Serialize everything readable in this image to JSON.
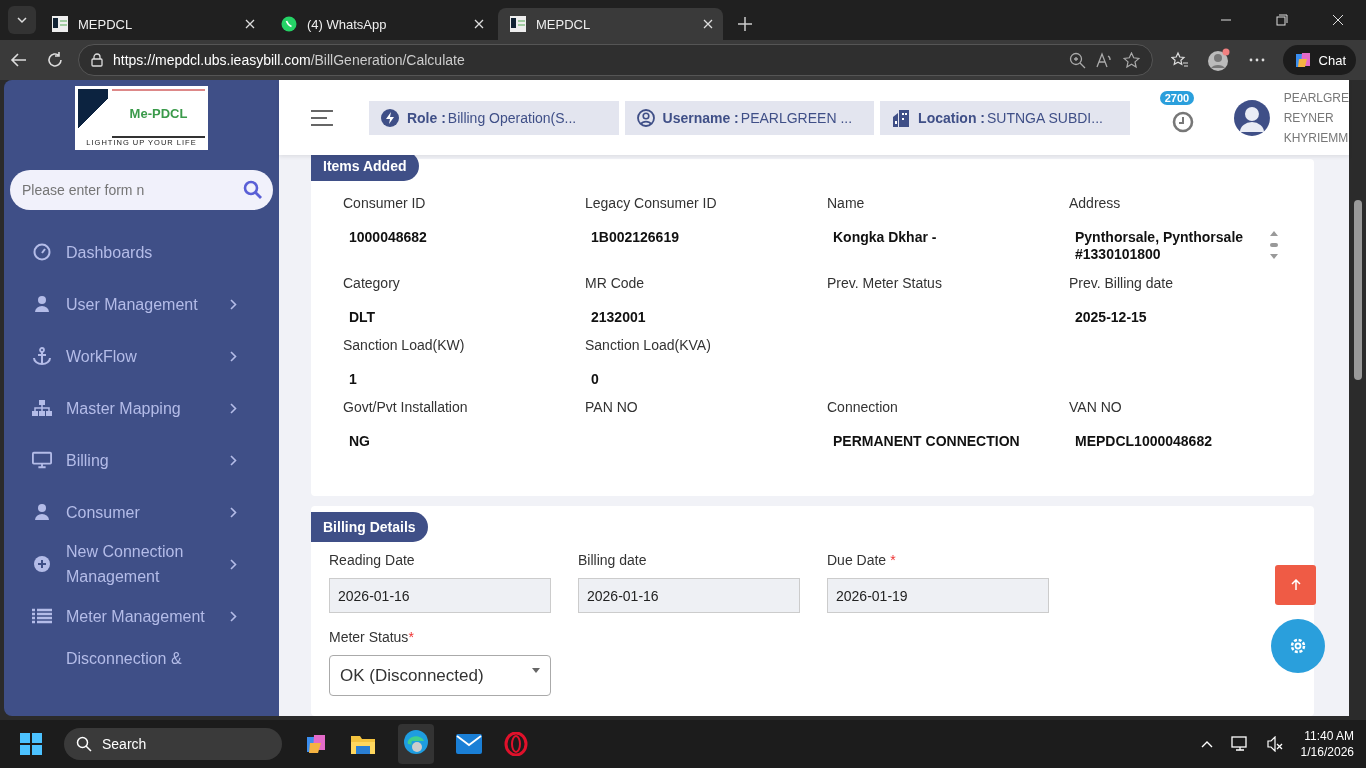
{
  "browser": {
    "tabs": [
      {
        "title": "MEPDCL",
        "selected": false
      },
      {
        "title": "(4) WhatsApp",
        "selected": false
      },
      {
        "title": "MEPDCL",
        "selected": true
      }
    ],
    "url_host": "https://mepdcl.ubs.ieasybill.com",
    "url_path": "/BillGeneration/Calculate",
    "chat": "Chat"
  },
  "sidebar": {
    "logo_text": "Me-PDCL",
    "logo_tagline": "LIGHTING UP YOUR LIFE",
    "search_placeholder": "Please enter form n",
    "items": [
      {
        "label": "Dashboards",
        "submenu": false
      },
      {
        "label": "User Management",
        "submenu": true
      },
      {
        "label": "WorkFlow",
        "submenu": true
      },
      {
        "label": "Master Mapping",
        "submenu": true
      },
      {
        "label": "Billing",
        "submenu": true
      },
      {
        "label": "Consumer",
        "submenu": true
      },
      {
        "label": "New Connection Management",
        "submenu": true
      },
      {
        "label": "Meter Management",
        "submenu": true
      },
      {
        "label": "Disconnection &",
        "submenu": false
      }
    ]
  },
  "header": {
    "chips": [
      {
        "label": "Role :",
        "value": "Billing Operation(S..."
      },
      {
        "label": "Username :",
        "value": "PEARLGREEN ..."
      },
      {
        "label": "Location :",
        "value": "SUTNGA SUBDI..."
      }
    ],
    "badge": "2700",
    "user_lines": [
      "PEARLGRE",
      "REYNER",
      "KHYRIEMM"
    ]
  },
  "items_added": {
    "title": "Items Added",
    "rows": [
      [
        {
          "label": "Consumer ID",
          "value": "1000048682"
        },
        {
          "label": "Legacy Consumer ID",
          "value": "1B002126619"
        },
        {
          "label": "Name",
          "value": "Kongka Dkhar -"
        },
        {
          "label": "Address",
          "value": "Pynthorsale, Pynthorsale #1330101800"
        }
      ],
      [
        {
          "label": "Category",
          "value": "DLT"
        },
        {
          "label": "MR Code",
          "value": "2132001"
        },
        {
          "label": "Prev. Meter Status"
        },
        {
          "label": "Prev. Billing date",
          "value": "2025-12-15"
        }
      ],
      [
        {
          "label": "Sanction Load(KW)",
          "value": "1"
        },
        {
          "label": "Sanction Load(KVA)",
          "value": "0"
        }
      ],
      [
        {
          "label": "Govt/Pvt Installation",
          "value": "NG"
        },
        {
          "label": "PAN NO"
        },
        {
          "label": "Connection",
          "value": "PERMANENT CONNECTION"
        },
        {
          "label": "VAN NO",
          "value": "MEPDCL1000048682"
        }
      ]
    ]
  },
  "billing": {
    "title": "Billing Details",
    "fields": [
      {
        "label": "Reading Date",
        "value": "2026-01-16"
      },
      {
        "label": "Billing date",
        "value": "2026-01-16"
      },
      {
        "label": "Due Date",
        "required_mark": "*",
        "value": "2026-01-19"
      }
    ],
    "meter_status": {
      "label": "Meter Status",
      "required_mark": "*",
      "value": "OK (Disconnected)"
    }
  },
  "taskbar": {
    "search": "Search",
    "time": "11:40 AM",
    "date": "1/16/2026"
  }
}
